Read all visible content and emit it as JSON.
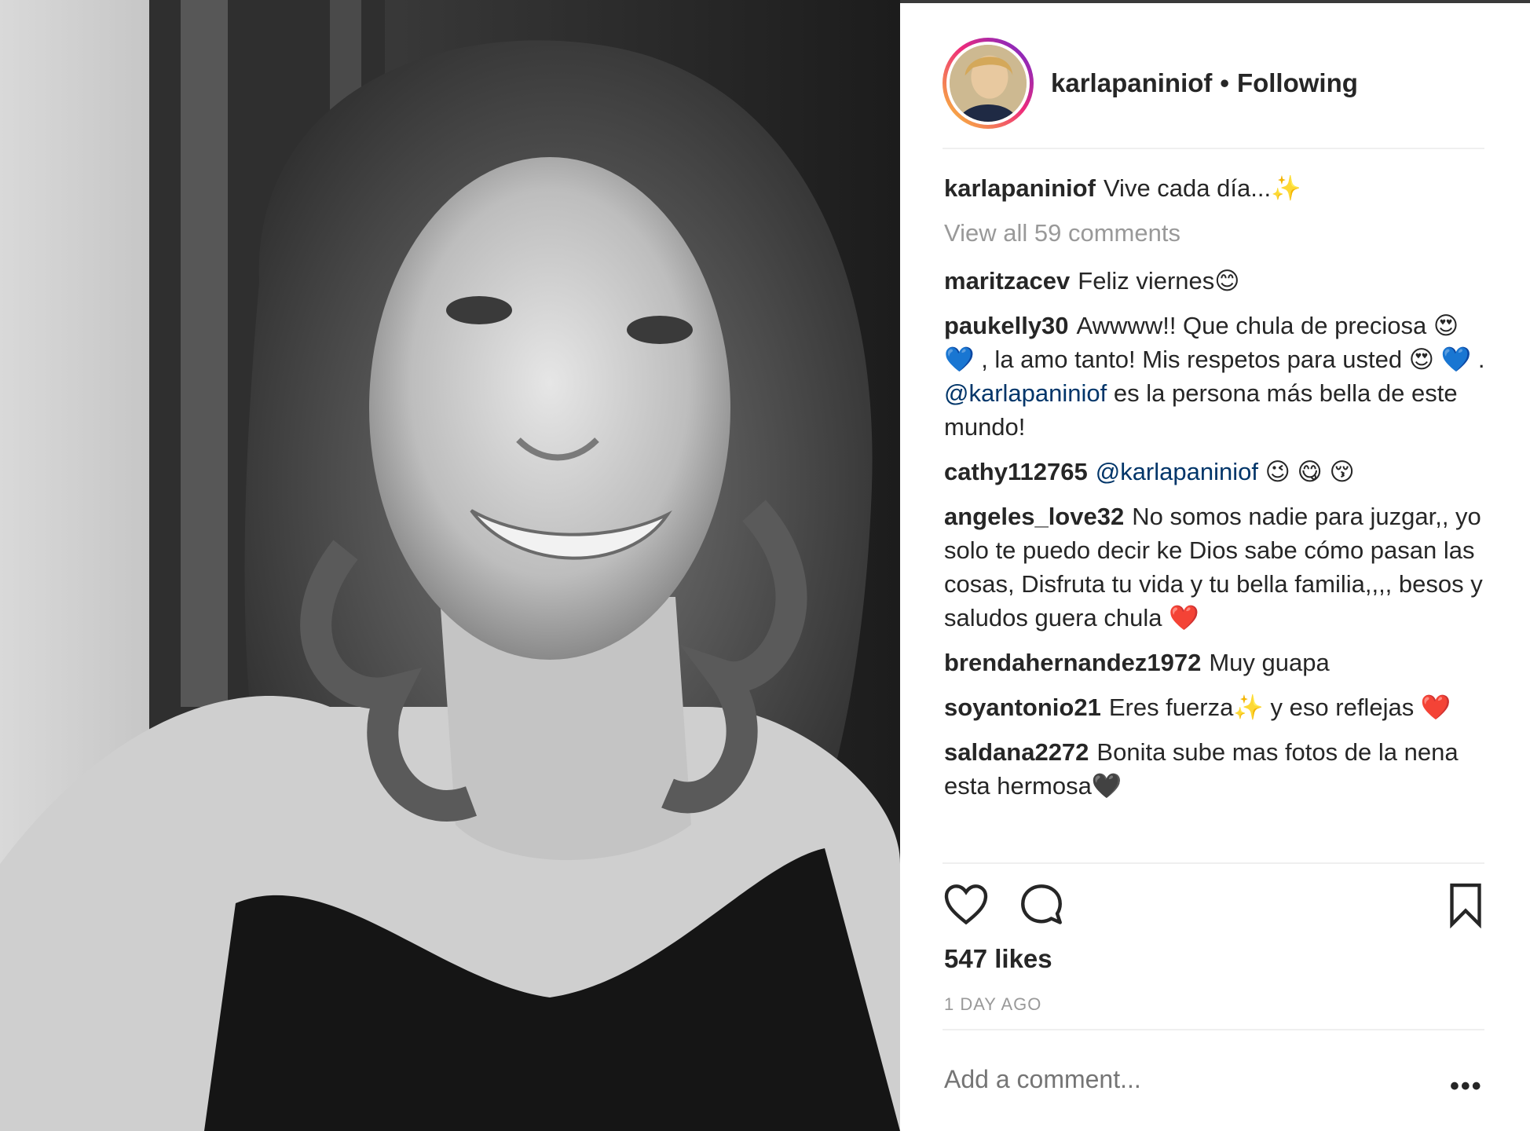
{
  "header": {
    "username": "karlapaniniof",
    "separator": "•",
    "follow_status": "Following"
  },
  "caption": {
    "username": "karlapaniniof",
    "text": "Vive cada día...✨"
  },
  "view_all_comments": "View all 59 comments",
  "comments": [
    {
      "user": "maritzacev",
      "text": "Feliz viernes😊"
    },
    {
      "user": "paukelly30",
      "text_before": "Awwww!! Que chula de preciosa 😍 💙 , la amo tanto! Mis respetos para usted 😍 💙 .",
      "mention": "@karlapaniniof",
      "text_after": "es la persona más bella de este mundo!"
    },
    {
      "user": "cathy112765",
      "mention": "@karlapaniniof",
      "text": "😉 😋 😚"
    },
    {
      "user": "angeles_love32",
      "text": "No somos nadie para juzgar,, yo solo te puedo decir ke Dios sabe cómo pasan las cosas, Disfruta tu vida y tu bella familia,,,, besos y saludos guera chula ❤️"
    },
    {
      "user": "brendahernandez1972",
      "text": "Muy guapa"
    },
    {
      "user": "soyantonio21",
      "text": "Eres fuerza✨  y eso reflejas ❤️"
    },
    {
      "user": "saldana2272",
      "text": "Bonita sube mas fotos de la nena esta hermosa🖤"
    }
  ],
  "actions": {
    "like_icon": "heart-outline-icon",
    "comment_icon": "comment-bubble-icon",
    "save_icon": "bookmark-icon"
  },
  "likes": "547 likes",
  "timestamp": "1 DAY AGO",
  "add_comment_placeholder": "Add a comment...",
  "more_options": "•••",
  "colors": {
    "text": "#262626",
    "muted": "#999999",
    "mention": "#003569",
    "divider": "#efefef"
  }
}
